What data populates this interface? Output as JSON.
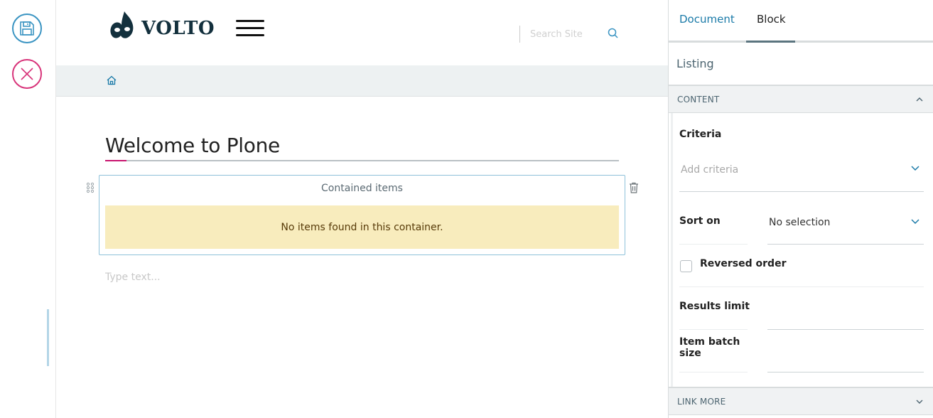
{
  "toolbar": {
    "save_icon": "floppy-disk-icon",
    "cancel_icon": "close-icon"
  },
  "header": {
    "logo_text": "VOLTO",
    "search_placeholder": "Search Site"
  },
  "page": {
    "title": "Welcome to Plone",
    "text_placeholder": "Type text..."
  },
  "listing_block": {
    "header": "Contained items",
    "empty_message": "No items found in this container."
  },
  "sidebar": {
    "tabs": [
      {
        "label": "Document",
        "active": false
      },
      {
        "label": "Block",
        "active": true
      }
    ],
    "heading": "Listing",
    "content_section": {
      "label": "CONTENT",
      "expanded": true,
      "criteria_label": "Criteria",
      "criteria_placeholder": "Add criteria",
      "sort_on_label": "Sort on",
      "sort_on_value": "No selection",
      "reversed_order_label": "Reversed order",
      "reversed_order_checked": false,
      "results_limit_label": "Results limit",
      "item_batch_size_label_line1": "Item batch",
      "item_batch_size_label_line2": "size"
    },
    "link_more_section": {
      "label": "LINK MORE",
      "expanded": false
    }
  },
  "colors": {
    "accent_blue": "#1a7aa8",
    "accent_pink": "#c8146e",
    "warning_bg": "#f8ecbd",
    "warning_text": "#573a08"
  }
}
